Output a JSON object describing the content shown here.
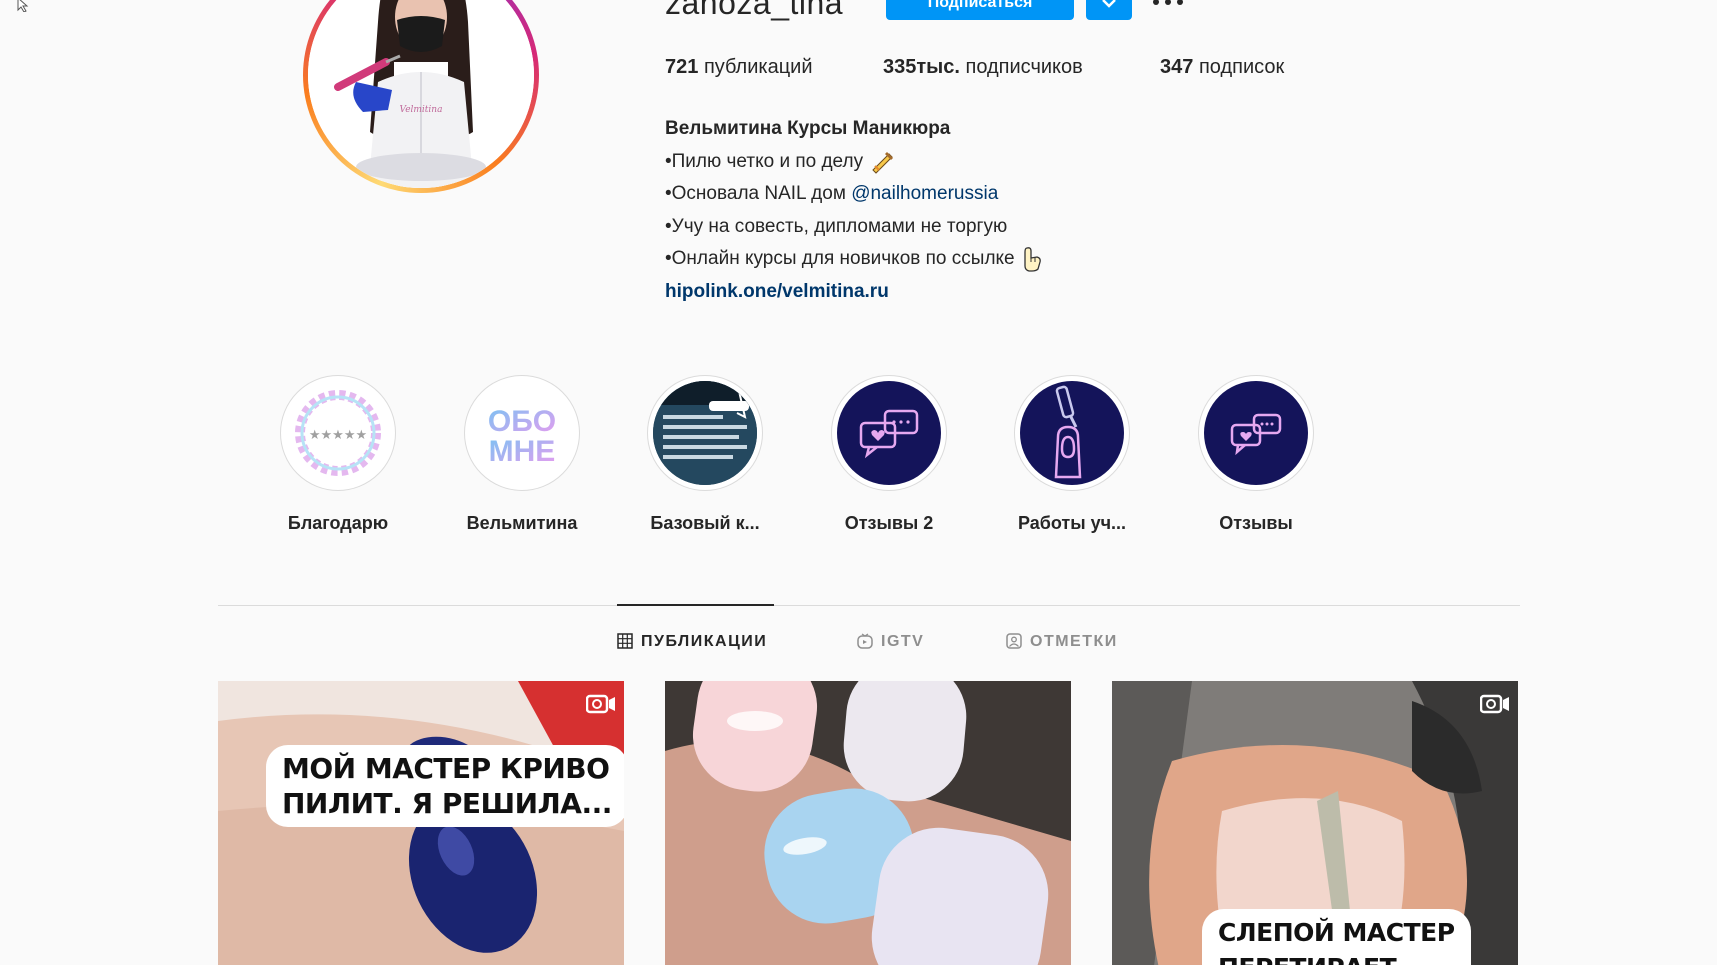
{
  "profile": {
    "username": "zanoza_tina",
    "follow_label": "Подписаться",
    "stats": {
      "posts_count": "721",
      "posts_label": "публикаций",
      "followers_count": "335тыс.",
      "followers_label": "подписчиков",
      "following_count": "347",
      "following_label": "подписок"
    },
    "bio": {
      "name": "Вельмитина Курсы Маникюра",
      "line1": "•Пилю четко и по делу",
      "line2_prefix": "•Основала NAIL дом ",
      "line2_mention": "@nailhomerussia",
      "line3": "•Учу на совесть, дипломами не торгую",
      "line4": "•Онлайн курсы для новичков по ссылке",
      "link": "hipolink.one/velmitina.ru"
    }
  },
  "highlights": [
    {
      "label": "Благодарю",
      "icon": "reviews-badge-icon"
    },
    {
      "label": "Вельмитина",
      "icon": "about-me-icon",
      "text_top": "ОБО",
      "text_bottom": "МНЕ"
    },
    {
      "label": "Базовый к...",
      "icon": "screenshot-thumbnail"
    },
    {
      "label": "Отзывы 2",
      "icon": "chat-heart-icon"
    },
    {
      "label": "Работы уч...",
      "icon": "nail-file-icon"
    },
    {
      "label": "Отзывы",
      "icon": "chat-heart-icon"
    }
  ],
  "tabs": [
    {
      "label": "ПУБЛИКАЦИИ",
      "icon": "grid-icon",
      "active": true
    },
    {
      "label": "IGTV",
      "icon": "igtv-icon",
      "active": false
    },
    {
      "label": "ОТМЕТКИ",
      "icon": "tagged-icon",
      "active": false
    }
  ],
  "posts": [
    {
      "caption_line1": "МОЙ МАСТЕР КРИВО",
      "caption_line2": "ПИЛИТ. Я РЕШИЛА...",
      "badge": "video-icon"
    },
    {
      "caption_line1": "",
      "caption_line2": "",
      "badge": ""
    },
    {
      "caption_line1": "СЛЕПОЙ МАСТЕР",
      "caption_line2": "ПЕРЕТИРАЕТ",
      "badge": "video-icon"
    }
  ],
  "colors": {
    "accent": "#0095f6",
    "link": "#00376b",
    "highlight_bg": "#14145a",
    "highlight_icon": "#e6a8f0"
  }
}
